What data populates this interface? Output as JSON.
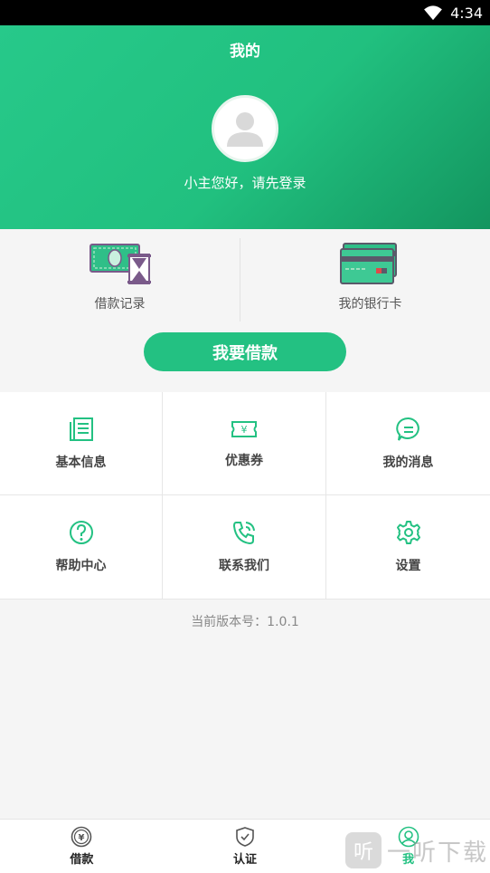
{
  "status_bar": {
    "time": "4:34"
  },
  "header": {
    "title": "我的",
    "greeting": "小主您好，请先登录"
  },
  "quick_actions": [
    {
      "label": "借款记录",
      "icon": "loan-record-icon"
    },
    {
      "label": "我的银行卡",
      "icon": "bank-card-icon"
    }
  ],
  "borrow_button": {
    "label": "我要借款"
  },
  "menu_grid": [
    {
      "label": "基本信息",
      "icon": "document-icon"
    },
    {
      "label": "优惠券",
      "icon": "coupon-icon"
    },
    {
      "label": "我的消息",
      "icon": "message-icon"
    },
    {
      "label": "帮助中心",
      "icon": "help-icon"
    },
    {
      "label": "联系我们",
      "icon": "phone-icon"
    },
    {
      "label": "设置",
      "icon": "gear-icon"
    }
  ],
  "version_text": "当前版本号：1.0.1",
  "tabbar": [
    {
      "label": "借款",
      "icon": "yen-coin-icon",
      "active": false
    },
    {
      "label": "认证",
      "icon": "shield-icon",
      "active": false
    },
    {
      "label": "我",
      "icon": "user-icon",
      "active": true
    }
  ],
  "watermark": {
    "text": "一听下载",
    "logo_char": "听"
  },
  "colors": {
    "primary": "#23c182",
    "header_gradient_start": "#27c98a",
    "header_gradient_end": "#13955f"
  }
}
